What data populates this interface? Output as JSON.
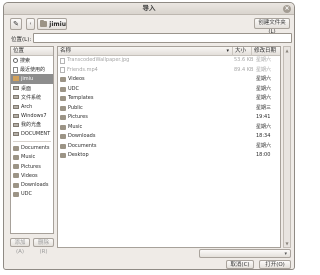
{
  "window": {
    "title": "导入"
  },
  "toolbar": {
    "edit_icon": "pencil-icon",
    "back_label": "‹",
    "path_label": "jimiu",
    "create_folder_label": "创建文件夹(L)"
  },
  "location": {
    "label": "位置(L):",
    "value": ""
  },
  "places": {
    "header": "位置",
    "items": [
      {
        "label": "搜索",
        "icon": "search-icon"
      },
      {
        "label": "最近使用的",
        "icon": "recent-icon"
      },
      {
        "label": "jimiu",
        "icon": "home-folder-icon",
        "selected": true
      },
      {
        "label": "桌面",
        "icon": "desktop-icon"
      },
      {
        "label": "文件系统",
        "icon": "drive-icon"
      },
      {
        "label": "Arch",
        "icon": "drive-icon"
      },
      {
        "label": "Windows7",
        "icon": "drive-icon"
      },
      {
        "label": "我的光盘",
        "icon": "drive-icon"
      },
      {
        "label": "DOCUMENT",
        "icon": "drive-icon"
      }
    ],
    "bookmarks": [
      {
        "label": "Documents",
        "icon": "folder-icon"
      },
      {
        "label": "Music",
        "icon": "folder-icon"
      },
      {
        "label": "Pictures",
        "icon": "folder-icon"
      },
      {
        "label": "Videos",
        "icon": "folder-icon"
      },
      {
        "label": "Downloads",
        "icon": "folder-icon"
      },
      {
        "label": "UDC",
        "icon": "folder-icon"
      }
    ],
    "add_label": "添加(A)",
    "remove_label": "删除(R)"
  },
  "files": {
    "columns": {
      "name": "名称",
      "size": "大小",
      "modified": "修改日期"
    },
    "rows": [
      {
        "name": "TranscodedWallpaper.jpg",
        "size": "53.6 KB",
        "modified": "星期六",
        "type": "file",
        "muted": true
      },
      {
        "name": "Friends.mp4",
        "size": "89.4 KB",
        "modified": "星期六",
        "type": "file",
        "muted": true
      },
      {
        "name": "Videos",
        "size": "",
        "modified": "星期六",
        "type": "folder"
      },
      {
        "name": "UDC",
        "size": "",
        "modified": "星期六",
        "type": "folder"
      },
      {
        "name": "Templates",
        "size": "",
        "modified": "星期六",
        "type": "folder"
      },
      {
        "name": "Public",
        "size": "",
        "modified": "星期三",
        "type": "folder"
      },
      {
        "name": "Pictures",
        "size": "",
        "modified": "19:41",
        "type": "folder"
      },
      {
        "name": "Music",
        "size": "",
        "modified": "星期六",
        "type": "folder"
      },
      {
        "name": "Downloads",
        "size": "",
        "modified": "18:34",
        "type": "folder"
      },
      {
        "name": "Documents",
        "size": "",
        "modified": "星期六",
        "type": "folder"
      },
      {
        "name": "Desktop",
        "size": "",
        "modified": "18:00",
        "type": "folder"
      }
    ]
  },
  "footer": {
    "filter_label": "",
    "cancel_label": "取消(C)",
    "open_label": "打开(O)"
  }
}
